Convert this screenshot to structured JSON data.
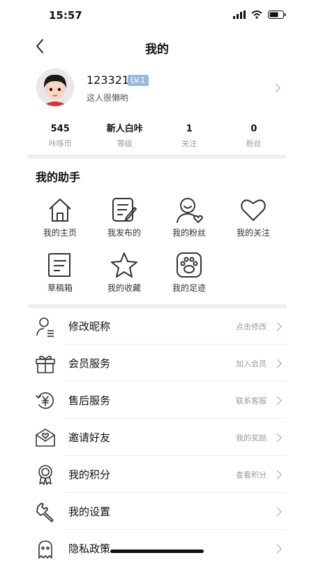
{
  "status_bar": {
    "time": "15:57"
  },
  "nav": {
    "title": "我的"
  },
  "profile": {
    "username": "123321",
    "level": "LV.1",
    "signature": "这人很懒哟"
  },
  "stats": [
    {
      "value": "545",
      "label": "咔哆币"
    },
    {
      "value": "新人白咔",
      "label": "等级"
    },
    {
      "value": "1",
      "label": "关注"
    },
    {
      "value": "0",
      "label": "粉丝"
    }
  ],
  "helper": {
    "title": "我的助手",
    "items": [
      {
        "label": "我的主页",
        "icon": "home-icon"
      },
      {
        "label": "我发布的",
        "icon": "edit-note-icon"
      },
      {
        "label": "我的粉丝",
        "icon": "person-heart-icon"
      },
      {
        "label": "我的关注",
        "icon": "heart-icon"
      },
      {
        "label": "草稿箱",
        "icon": "draft-icon"
      },
      {
        "label": "我的收藏",
        "icon": "star-icon"
      },
      {
        "label": "我的足迹",
        "icon": "paw-icon"
      }
    ]
  },
  "menu": [
    {
      "label": "修改昵称",
      "hint": "点击修改",
      "icon": "user-edit-icon"
    },
    {
      "label": "会员服务",
      "hint": "加入会员",
      "icon": "gift-icon"
    },
    {
      "label": "售后服务",
      "hint": "联系客服",
      "icon": "yen-refresh-icon"
    },
    {
      "label": "邀请好友",
      "hint": "我的奖励",
      "icon": "mail-heart-icon"
    },
    {
      "label": "我的积分",
      "hint": "查看积分",
      "icon": "medal-icon"
    },
    {
      "label": "我的设置",
      "hint": "",
      "icon": "wrench-icon"
    },
    {
      "label": "隐私政策",
      "hint": "",
      "icon": "ghost-icon"
    }
  ]
}
